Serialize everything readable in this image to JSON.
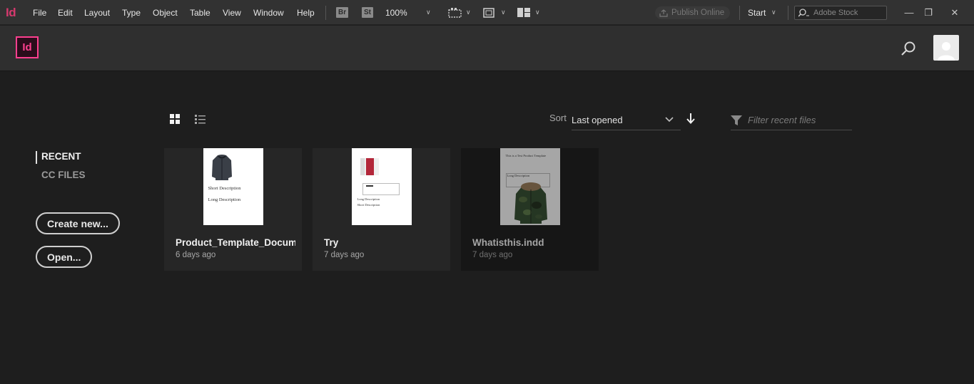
{
  "menubar": {
    "app_glyph": "Id",
    "menus": [
      "File",
      "Edit",
      "Layout",
      "Type",
      "Object",
      "Table",
      "View",
      "Window",
      "Help"
    ],
    "bridge_badge": "Br",
    "stock_badge": "St",
    "zoom": "100%",
    "publish_label": "Publish Online",
    "workspace": "Start",
    "stock_search_placeholder": "Adobe Stock"
  },
  "header": {
    "logo_text": "Id",
    "logo_color": "#ff3f8f"
  },
  "toolbar": {
    "sort_label": "Sort",
    "sort_value": "Last opened",
    "filter_placeholder": "Filter recent files"
  },
  "sidebar": {
    "items": [
      {
        "label": "RECENT",
        "active": true
      },
      {
        "label": "CC FILES",
        "active": false
      }
    ],
    "create_button": "Create new...",
    "open_button": "Open..."
  },
  "files": [
    {
      "name": "Product_Template_Docum...",
      "date": "6 days ago",
      "thumb_lines": [
        "Short Description",
        "Long Description"
      ]
    },
    {
      "name": "Try",
      "date": "7 days ago",
      "thumb_lines": [
        "Long Description",
        "Short Description"
      ]
    },
    {
      "name": "Whatisthis.indd",
      "date": "7 days ago",
      "thumb_lines": [
        "This is a Test Product Template",
        "Long Description"
      ]
    }
  ]
}
